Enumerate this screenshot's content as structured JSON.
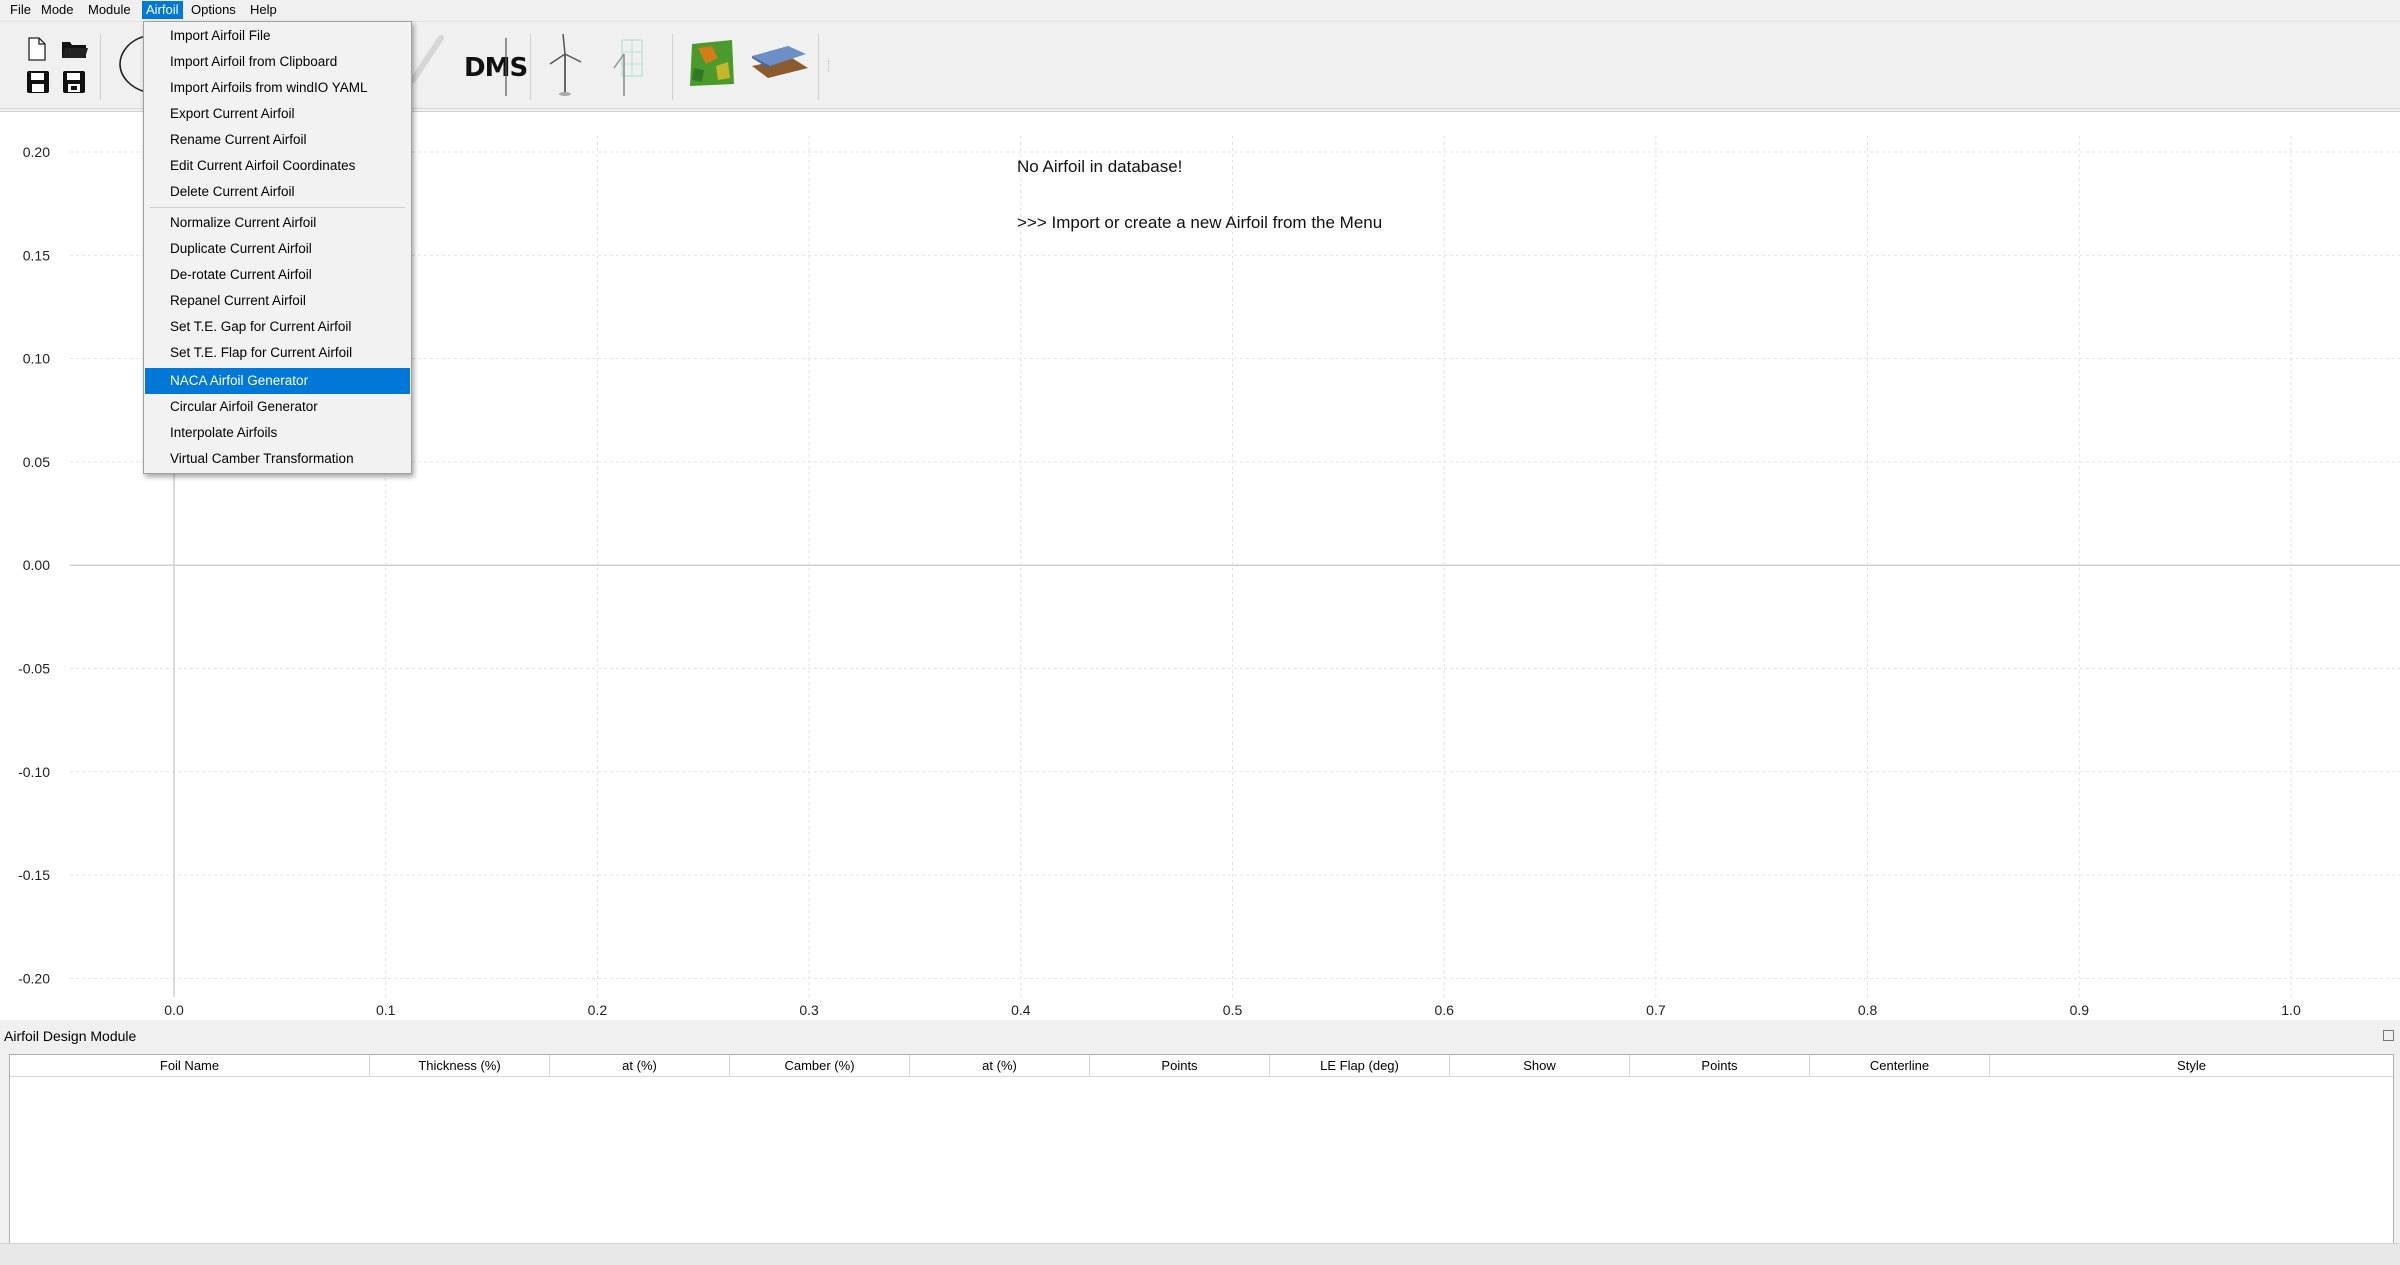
{
  "menubar": {
    "items": [
      "File",
      "Mode",
      "Module",
      "Airfoil",
      "Options",
      "Help"
    ],
    "active": "Airfoil"
  },
  "toolbar": {
    "dms_label": "DMS"
  },
  "airfoil_menu": {
    "items": [
      "Import Airfoil File",
      "Import Airfoil from Clipboard",
      "Import Airfoils from windIO YAML",
      "Export Current Airfoil",
      "Rename Current Airfoil",
      "Edit Current Airfoil Coordinates",
      "Delete Current Airfoil",
      "Normalize Current Airfoil",
      "Duplicate Current Airfoil",
      "De-rotate Current Airfoil",
      "Repanel Current Airfoil",
      "Set T.E. Gap for Current Airfoil",
      "Set T.E. Flap for Current Airfoil",
      "NACA Airfoil Generator",
      "Circular Airfoil Generator",
      "Interpolate Airfoils",
      "Virtual Camber Transformation"
    ],
    "highlighted": "NACA Airfoil Generator"
  },
  "plot": {
    "message_line1": "No Airfoil in database!",
    "message_line2": ">>> Import or create a new Airfoil from the Menu",
    "y_ticks": [
      "0.20",
      "0.15",
      "0.10",
      "0.05",
      "0.00",
      "-0.05",
      "-0.10",
      "-0.15",
      "-0.20"
    ],
    "x_ticks": [
      "0.0",
      "0.1",
      "0.2",
      "0.3",
      "0.4",
      "0.5",
      "0.6",
      "0.7",
      "0.8",
      "0.9",
      "1.0"
    ]
  },
  "dock": {
    "title": "Airfoil Design Module",
    "columns": [
      "Foil Name",
      "Thickness (%)",
      "at (%)",
      "Camber (%)",
      "at (%)",
      "Points",
      "LE Flap (deg)",
      "Show",
      "Points",
      "Centerline",
      "Style"
    ],
    "rows": []
  },
  "colors": {
    "highlight": "#0078d7",
    "grid": "#e2e2e2",
    "axis": "#cfcfcf"
  }
}
